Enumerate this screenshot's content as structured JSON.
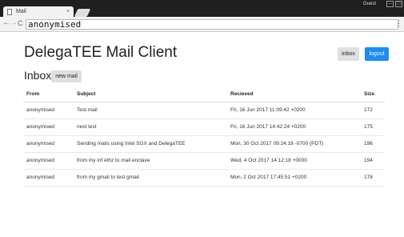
{
  "browser": {
    "tab_title": "Mail",
    "tab_close": "×",
    "guest_label": "Guest",
    "win_min": "–",
    "win_max": "□",
    "back": "←",
    "forward": "→",
    "reload": "C",
    "url": "anonymised",
    "menu": "⋮"
  },
  "app": {
    "title": "DelegaTEE Mail Client",
    "inbox_button": "inbox",
    "logout_button": "logout"
  },
  "inbox": {
    "heading": "Inbox",
    "new_mail_button": "new mail",
    "columns": [
      "From",
      "Subject",
      "Recieved",
      "Size"
    ],
    "rows": [
      [
        "anonymised",
        "Test mail",
        "Fri, 16 Jun 2017 11:09:42 +0200",
        "172"
      ],
      [
        "anonymised",
        "next test",
        "Fri, 16 Jun 2017 14:42:24 +0200",
        "175"
      ],
      [
        "anonymised",
        "Sending mails using Intel SGX and DelegaTEE",
        "Mon, 30 Oct 2017 09:24:18 -0700 (PDT)",
        "196"
      ],
      [
        "anonymised",
        "from my inf ethz to mail enclave",
        "Wed, 4 Oct 2017 14:12:18 +0000",
        "194"
      ],
      [
        "anonymised",
        "from my gmail to test gmail",
        "Mon, 2 Oct 2017 17:45:51 +0200",
        "178"
      ]
    ]
  },
  "colors": {
    "accent": "#1a8df5",
    "button_gray": "#e0e0e0",
    "chrome_dark": "#1f1f1f"
  }
}
